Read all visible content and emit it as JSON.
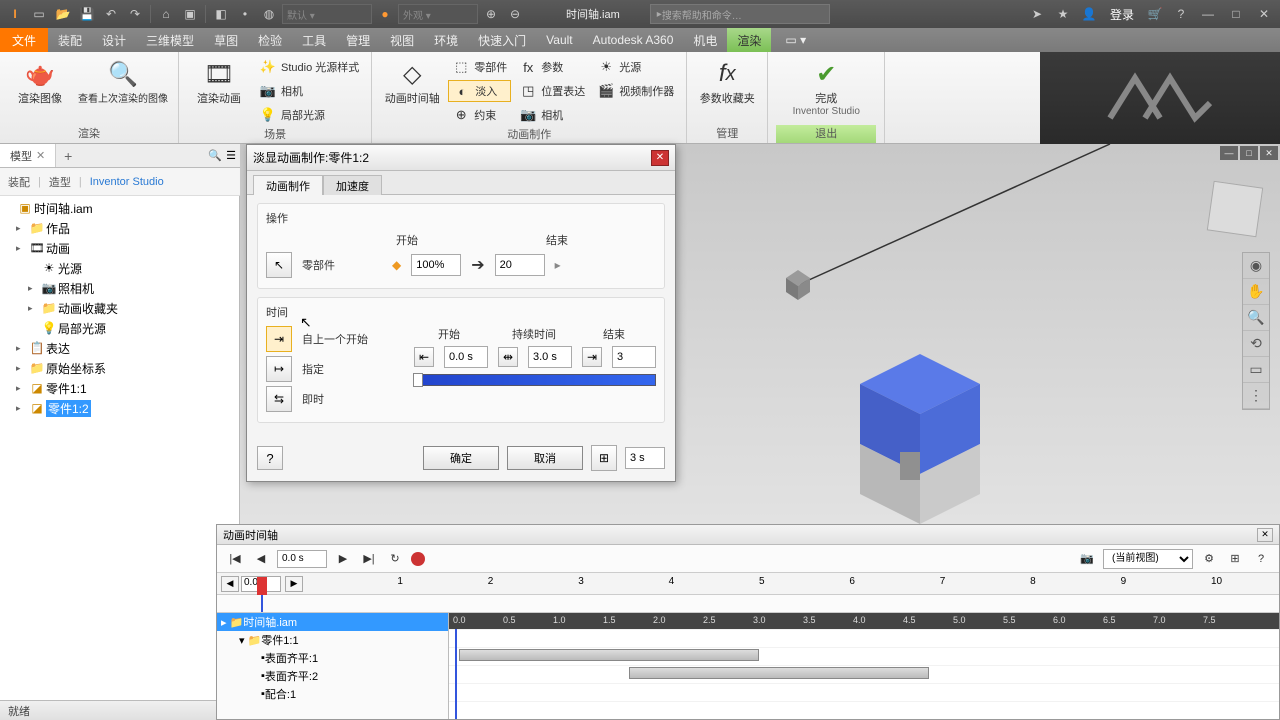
{
  "titlebar": {
    "doc_title": "时间轴.iam",
    "search_placeholder": "搜索帮助和命令…",
    "login": "登录"
  },
  "ribbon_tabs": {
    "file": "文件",
    "items": [
      "装配",
      "设计",
      "三维模型",
      "草图",
      "检验",
      "工具",
      "管理",
      "视图",
      "环境",
      "快速入门",
      "Vault",
      "Autodesk A360",
      "机电",
      "渲染"
    ]
  },
  "ribbon": {
    "g1_label": "渲染",
    "g1_big1": "渲染图像",
    "g1_big2": "查看上次渲染的图像",
    "g2_label": "场景",
    "g2_big": "渲染动画",
    "g2_s1": "Studio 光源样式",
    "g2_s2": "相机",
    "g2_s3": "局部光源",
    "g3_label": "",
    "g3_big": "动画时间轴",
    "g3_s1": "零部件",
    "g3_s2": "淡入",
    "g3_s3": "约束",
    "g4_s1": "参数",
    "g4_s2": "位置表达",
    "g4_s3": "相机",
    "g5_s1": "光源",
    "g5_s2": "视频制作器",
    "g5_label": "动画制作",
    "g6_big": "参数收藏夹",
    "g6_label": "管理",
    "g7_big": "完成",
    "g7_sub": "Inventor Studio",
    "g7_label": "退出"
  },
  "panel": {
    "tab": "模型"
  },
  "subtabs": {
    "m1": "装配",
    "m2": "造型",
    "m3": "Inventor Studio"
  },
  "tree": {
    "root": "时间轴.iam",
    "n1": "作品",
    "n2": "动画",
    "n3": "光源",
    "n4": "照相机",
    "n5": "动画收藏夹",
    "n6": "局部光源",
    "n7": "表达",
    "n8": "原始坐标系",
    "n9": "零件1:1",
    "n10": "零件1:2"
  },
  "dialog": {
    "title": "淡显动画制作:零件1:2",
    "tab1": "动画制作",
    "tab2": "加速度",
    "sec1": "操作",
    "pick": "零部件",
    "start_lbl": "开始",
    "end_lbl": "结束",
    "start_val": "100%",
    "end_val": "20",
    "sec2": "时间",
    "t_mode1": "自上一个开始",
    "t_mode2": "指定",
    "t_mode3": "即时",
    "t_start_lbl": "开始",
    "t_dur_lbl": "持续时间",
    "t_end_lbl": "结束",
    "t_start": "0.0 s",
    "t_dur": "3.0 s",
    "t_end": "3",
    "ok": "确定",
    "cancel": "取消",
    "total": "3 s"
  },
  "timeline": {
    "title": "动画时间轴",
    "cur_time": "0.0 s",
    "view_sel": "(当前视图)",
    "pos": "0.0",
    "tree_root": "时间轴.iam",
    "tree_n1": "零件1:1",
    "tree_n2": "表面齐平:1",
    "tree_n3": "表面齐平:2",
    "tree_n4": "配合:1",
    "ruler_major": [
      "1",
      "2",
      "3",
      "4",
      "5",
      "6",
      "7",
      "8",
      "9",
      "10"
    ],
    "ruler_minor": [
      "0.0",
      "0.5",
      "1.0",
      "1.5",
      "2.0",
      "2.5",
      "3.0",
      "3.5",
      "4.0",
      "4.5",
      "5.0",
      "5.5",
      "6.0",
      "6.5",
      "7.0",
      "7.5"
    ]
  },
  "status": "就绪"
}
